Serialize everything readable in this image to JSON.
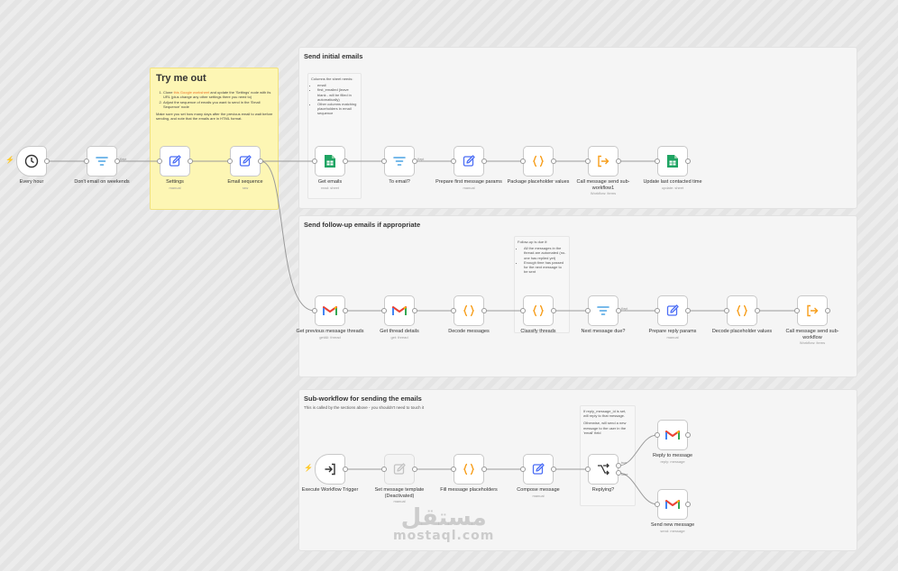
{
  "colors": {
    "accent": "#ff6d5a",
    "gmail_red": "#ea4335",
    "sheets_green": "#1fa463",
    "filter_blue": "#4ba3e3",
    "edit_blue": "#4c6ef5",
    "code_orange": "#f79e1b"
  },
  "sections": {
    "initial": {
      "title": "Send initial emails"
    },
    "followup": {
      "title": "Send follow-up emails if appropriate"
    },
    "subworkflow": {
      "title": "Sub-workflow for sending the emails",
      "subtitle": "This is called by the sections above - you shouldn't need to touch it"
    }
  },
  "sticky_try": {
    "title": "Try me out",
    "step1_a": "Clone ",
    "step1_link": "this Google worksheet",
    "step1_b": " and update the 'Settings' node with its URL (plus change any other settings there you need to)",
    "step2": "Adjust the sequence of emails you want to send in the 'Email Sequence' node",
    "para": "Make sure you set how many days after the previous email to wait before sending, and note that the emails are in HTML format."
  },
  "note_columns": {
    "intro": "Columns the sheet needs:",
    "items": [
      "email",
      "first_emailed (leave blank - will be filled in automatically)",
      "Other columns matching placeholders in email sequence"
    ]
  },
  "note_followup": {
    "intro": "Follow-up is due if:",
    "items": [
      "All the messages in the thread are automated (no-one has replied yet)",
      "Enough time has passed for the next message to be sent"
    ]
  },
  "note_reply": {
    "p1": "If reply_message_id is set, will reply to that message.",
    "p2": "Otherwise, will send a new message to the user in the 'email' field"
  },
  "nodes": {
    "every_hour": {
      "label": "Every hour",
      "icon": "clock-icon"
    },
    "weekends": {
      "label": "Don't email on weekends",
      "icon": "filter-icon"
    },
    "settings": {
      "label": "Settings",
      "sub": "manual",
      "icon": "pencil-icon"
    },
    "email_seq": {
      "label": "Email sequence",
      "sub": "raw",
      "icon": "pencil-icon"
    },
    "get_emails": {
      "label": "Get emails",
      "sub": "read: sheet",
      "icon": "sheets-icon"
    },
    "to_email": {
      "label": "To email?",
      "icon": "filter-icon"
    },
    "prep_first": {
      "label": "Prepare first message params",
      "sub": "manual",
      "icon": "pencil-icon"
    },
    "package_ph": {
      "label": "Package placeholder values",
      "icon": "code-braces-icon"
    },
    "call_send_1": {
      "label": "Call message send sub-workflow1",
      "sub": "Workflow: items",
      "icon": "execute-workflow-icon"
    },
    "update_last": {
      "label": "Update last contacted time",
      "sub": "update: sheet",
      "icon": "sheets-icon"
    },
    "get_prev": {
      "label": "Get previous message threads",
      "sub": "getAll: thread",
      "icon": "gmail-icon"
    },
    "get_thread": {
      "label": "Get thread details",
      "sub": "get: thread",
      "icon": "gmail-icon"
    },
    "decode_msgs": {
      "label": "Decode messages",
      "icon": "code-braces-icon"
    },
    "classify": {
      "label": "Classify threads",
      "icon": "code-braces-icon"
    },
    "next_due": {
      "label": "Next message due?",
      "icon": "filter-icon"
    },
    "prep_reply": {
      "label": "Prepare reply params",
      "sub": "manual",
      "icon": "pencil-icon"
    },
    "decode_ph": {
      "label": "Decode placeholder values",
      "icon": "code-braces-icon"
    },
    "call_send_2": {
      "label": "Call message send sub-workflow",
      "sub": "Workflow: items",
      "icon": "execute-workflow-icon"
    },
    "exec_trigger": {
      "label": "Execute Workflow Trigger",
      "icon": "enter-icon"
    },
    "set_template": {
      "label": "Set message template (Deactivated)",
      "sub": "manual",
      "icon": "pencil-icon"
    },
    "fill_ph": {
      "label": "Fill message placeholders",
      "icon": "code-braces-icon"
    },
    "compose": {
      "label": "Compose message",
      "sub": "manual",
      "icon": "pencil-icon"
    },
    "replying": {
      "label": "Replying?",
      "icon": "branch-icon"
    },
    "reply_msg": {
      "label": "Reply to message",
      "sub": "reply: message",
      "icon": "gmail-icon"
    },
    "send_new": {
      "label": "Send new message",
      "sub": "send: message",
      "icon": "gmail-icon"
    }
  },
  "edge_labels": {
    "kept": "Kept",
    "true": "true",
    "false": "false"
  },
  "watermark": {
    "arabic": "مستقل",
    "latin": "mostaql.com"
  }
}
